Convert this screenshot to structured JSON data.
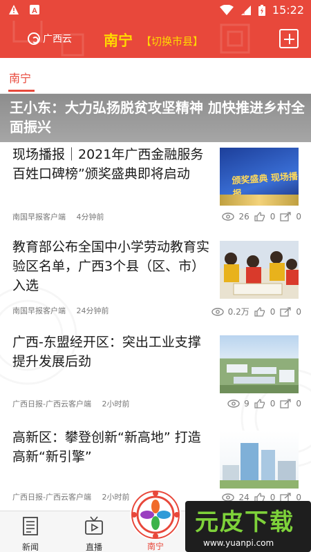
{
  "status_bar": {
    "time": "15:22"
  },
  "header": {
    "logo_text": "广西云",
    "city": "南宁",
    "switch_label": "【切换市县】"
  },
  "tabs": {
    "active": "南宁"
  },
  "banner": {
    "headline": "王小东：大力弘扬脱贫攻坚精神 加快推进乡村全面振兴"
  },
  "news": [
    {
      "title": "现场播报｜2021年广西金融服务百姓口碑榜”颁奖盛典即将启动",
      "source": "南国早报客户端",
      "time": "4分钟前",
      "views": "26",
      "likes": "0",
      "shares": "0",
      "thumb_text": "颁奖盛典 现场播报"
    },
    {
      "title": "教育部公布全国中小学劳动教育实验区名单，广西3个县（区、市）入选",
      "source": "南国早报客户端",
      "time": "24分钟前",
      "views": "0.2万",
      "likes": "0",
      "shares": "0"
    },
    {
      "title": "广西-东盟经开区：突出工业支撑 提升发展后劲",
      "source": "广西日报-广西云客户端",
      "time": "2小时前",
      "views": "9",
      "likes": "0",
      "shares": "0"
    },
    {
      "title": "高新区：攀登创新“新高地” 打造高新“新引擎”",
      "source": "广西日报-广西云客户端",
      "time": "2小时前",
      "views": "24",
      "likes": "0",
      "shares": "0"
    }
  ],
  "bottom_nav": {
    "news": "新闻",
    "live": "直播",
    "city": "南宁"
  },
  "watermark": {
    "title": "元皮下载",
    "url": "www.yuanpi.com"
  },
  "colors": {
    "brand_red": "#e8483b",
    "accent_yellow": "#ffd900",
    "watermark_green": "#7ed23a"
  }
}
